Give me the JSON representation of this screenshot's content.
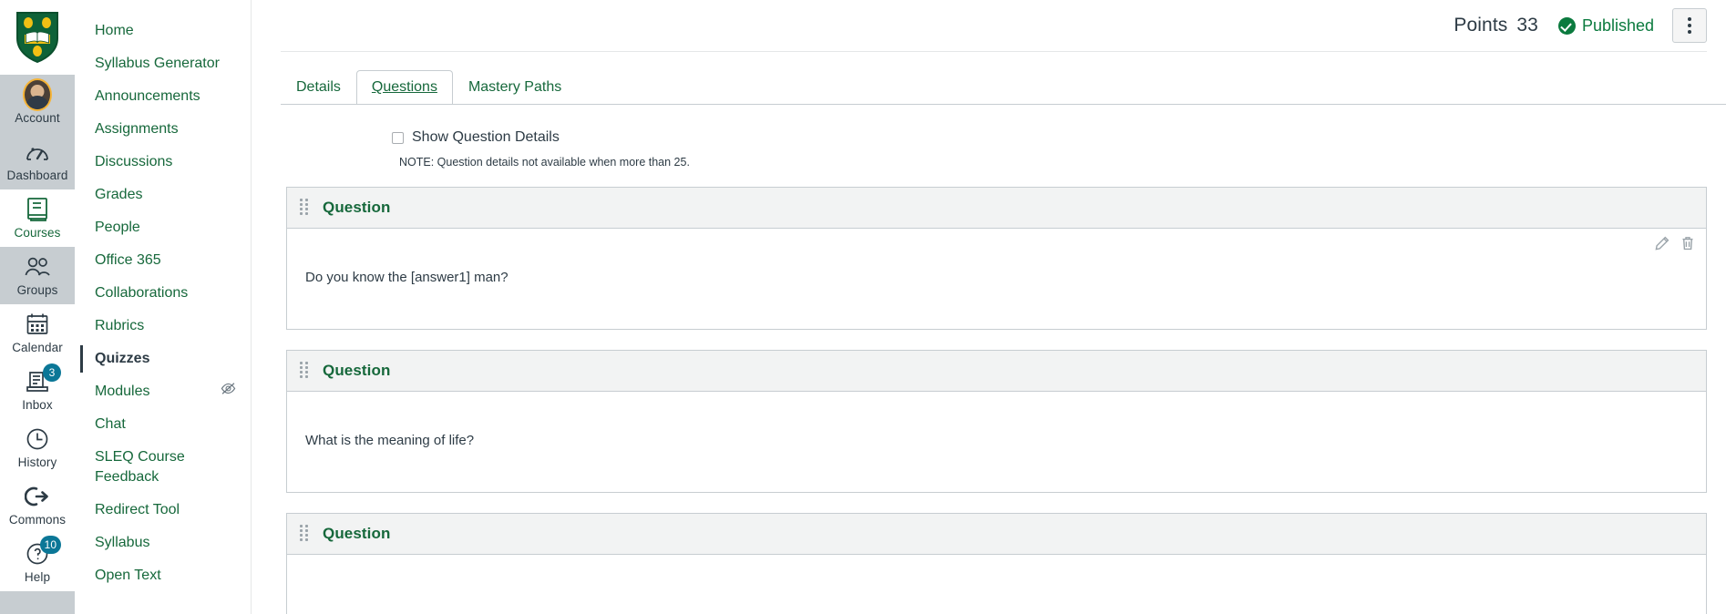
{
  "global_nav": {
    "logo_name": "university-shield-logo",
    "items": [
      {
        "label": "Account",
        "icon": "avatar-icon",
        "badge": null,
        "active": false
      },
      {
        "label": "Dashboard",
        "icon": "dashboard-gauge-icon",
        "badge": null,
        "active": false
      },
      {
        "label": "Courses",
        "icon": "courses-book-icon",
        "badge": null,
        "active": true
      },
      {
        "label": "Groups",
        "icon": "groups-people-icon",
        "badge": null,
        "active": false
      },
      {
        "label": "Calendar",
        "icon": "calendar-icon",
        "badge": null,
        "active": false
      },
      {
        "label": "Inbox",
        "icon": "inbox-icon",
        "badge": "3",
        "active": false
      },
      {
        "label": "History",
        "icon": "history-clock-icon",
        "badge": null,
        "active": false
      },
      {
        "label": "Commons",
        "icon": "commons-arrow-icon",
        "badge": null,
        "active": false
      },
      {
        "label": "Help",
        "icon": "help-question-icon",
        "badge": "10",
        "active": false
      }
    ],
    "badge_color": "#0b7797"
  },
  "course_nav": {
    "items": [
      {
        "label": "Home",
        "active": false,
        "hidden_icon": false
      },
      {
        "label": "Syllabus Generator",
        "active": false,
        "hidden_icon": false
      },
      {
        "label": "Announcements",
        "active": false,
        "hidden_icon": false
      },
      {
        "label": "Assignments",
        "active": false,
        "hidden_icon": false
      },
      {
        "label": "Discussions",
        "active": false,
        "hidden_icon": false
      },
      {
        "label": "Grades",
        "active": false,
        "hidden_icon": false
      },
      {
        "label": "People",
        "active": false,
        "hidden_icon": false
      },
      {
        "label": "Office 365",
        "active": false,
        "hidden_icon": false
      },
      {
        "label": "Collaborations",
        "active": false,
        "hidden_icon": false
      },
      {
        "label": "Rubrics",
        "active": false,
        "hidden_icon": false
      },
      {
        "label": "Quizzes",
        "active": true,
        "hidden_icon": false
      },
      {
        "label": "Modules",
        "active": false,
        "hidden_icon": true
      },
      {
        "label": "Chat",
        "active": false,
        "hidden_icon": false
      },
      {
        "label": "SLEQ Course Feedback",
        "active": false,
        "hidden_icon": false
      },
      {
        "label": "Redirect Tool",
        "active": false,
        "hidden_icon": false
      },
      {
        "label": "Syllabus",
        "active": false,
        "hidden_icon": false
      },
      {
        "label": "Open Text",
        "active": false,
        "hidden_icon": false
      }
    ],
    "link_color": "#16683b"
  },
  "header": {
    "points_label": "Points",
    "points_value": "33",
    "published_label": "Published",
    "published_color": "#0b7a3e",
    "kebab_name": "more-options-button"
  },
  "tabs": [
    {
      "label": "Details",
      "active": false
    },
    {
      "label": "Questions",
      "active": true
    },
    {
      "label": "Mastery Paths",
      "active": false
    }
  ],
  "question_details": {
    "checkbox_label": "Show Question Details",
    "checked": false,
    "note": "NOTE: Question details not available when more than 25."
  },
  "questions": [
    {
      "title": "Question",
      "text": "Do you know the [answer1] man?",
      "has_actions": true
    },
    {
      "title": "Question",
      "text": "What is the meaning of life?",
      "has_actions": false
    },
    {
      "title": "Question",
      "text": "",
      "has_actions": false
    }
  ],
  "icons": {
    "edit": "pencil-edit-icon",
    "delete": "trash-delete-icon",
    "drag": "drag-handle-icon",
    "hidden": "eye-slash-hidden-icon"
  }
}
